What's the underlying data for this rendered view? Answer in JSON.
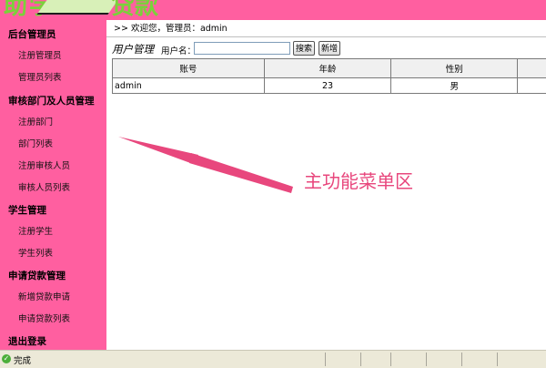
{
  "header": {
    "logo_text_left": "助学",
    "logo_text_right": "贷款"
  },
  "sidebar": {
    "groups": [
      {
        "label": "后台管理员",
        "items": [
          "注册管理员",
          "管理员列表"
        ]
      },
      {
        "label": "审核部门及人员管理",
        "items": [
          "注册部门",
          "部门列表",
          "注册审核人员",
          "审核人员列表"
        ]
      },
      {
        "label": "学生管理",
        "items": [
          "注册学生",
          "学生列表"
        ]
      },
      {
        "label": "申请贷款管理",
        "items": [
          "新增贷款申请",
          "申请贷款列表"
        ]
      },
      {
        "label": "退出登录",
        "items": []
      }
    ]
  },
  "welcome": {
    "text": ">> 欢迎您，管理员：admin"
  },
  "search": {
    "page_title": "用户管理",
    "username_label": "用户名：",
    "username_value": "",
    "search_button": "搜索",
    "add_button": "新增"
  },
  "table": {
    "columns": [
      "账号",
      "年龄",
      "性别",
      ""
    ],
    "rows": [
      [
        "admin",
        "23",
        "男",
        ""
      ]
    ]
  },
  "annotation": {
    "text": "主功能菜单区",
    "color": "#e8477d"
  },
  "statusbar": {
    "text": "完成",
    "icon": "check-circle-icon"
  },
  "colors": {
    "sidebar_bg": "#ff5fa0",
    "header_bg": "#ff5fa0",
    "annotation": "#e8477d"
  }
}
